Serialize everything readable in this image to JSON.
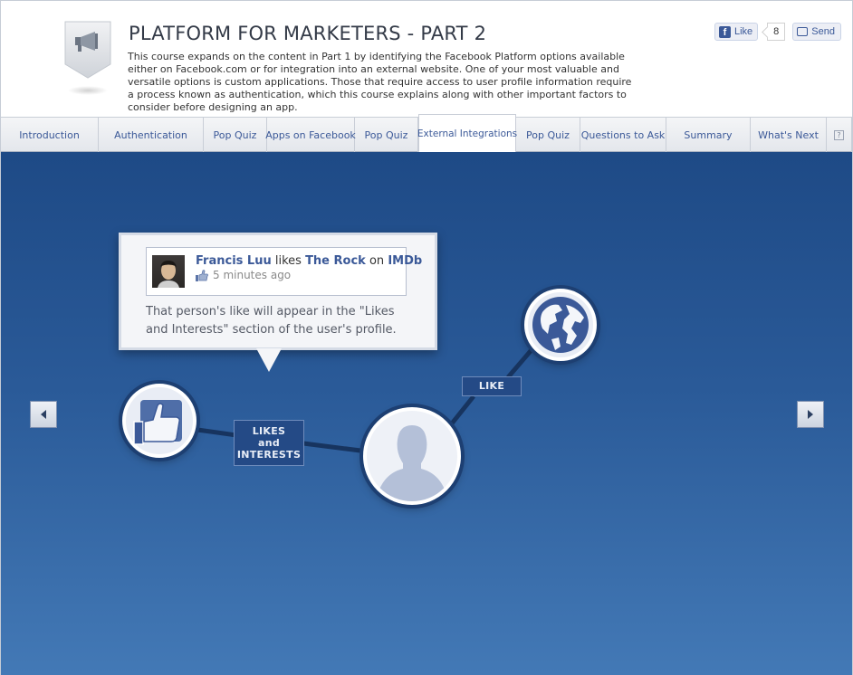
{
  "course": {
    "title": "PLATFORM FOR MARKETERS - PART 2",
    "description": "This course expands on the content in Part 1 by identifying the Facebook Platform options available either on Facebook.com or for integration into an external website. One of your most valuable and versatile options is custom applications. Those that require access to user profile information require a process known as authentication, which this course explains along with other important factors to consider before designing an app."
  },
  "social": {
    "like_label": "Like",
    "like_count": "8",
    "send_label": "Send"
  },
  "tabs": [
    {
      "label": "Introduction"
    },
    {
      "label": "Authentication"
    },
    {
      "label": "Pop Quiz"
    },
    {
      "label": "Apps on Facebook"
    },
    {
      "label": "Pop Quiz"
    },
    {
      "label": "External Integrations",
      "active": true
    },
    {
      "label": "Pop Quiz"
    },
    {
      "label": "Questions to Ask"
    },
    {
      "label": "Summary"
    },
    {
      "label": "What's Next"
    }
  ],
  "help_label": "?",
  "callout": {
    "story_user": "Francis Luu",
    "story_verb": "likes",
    "story_object": "The Rock",
    "story_prep": "on",
    "story_site": "IMDb",
    "story_time": "5 minutes ago",
    "text": "That person's like will appear in the \"Likes and Interests\" section of the user's profile."
  },
  "labels": {
    "likes_line1": "LIKES",
    "likes_line2": "and",
    "likes_line3": "INTERESTS",
    "like": "LIKE"
  },
  "colors": {
    "stage_top": "#1e4a86",
    "stage_bottom": "#4379b6",
    "facebook_blue": "#3b5998",
    "label_bg": "#244a86"
  },
  "icons": {
    "header_badge": "megaphone-icon",
    "like_node": "thumbs-up-icon",
    "person_node": "person-silhouette-icon",
    "globe_node": "globe-icon",
    "prev": "arrow-left-icon",
    "next": "arrow-right-icon"
  }
}
